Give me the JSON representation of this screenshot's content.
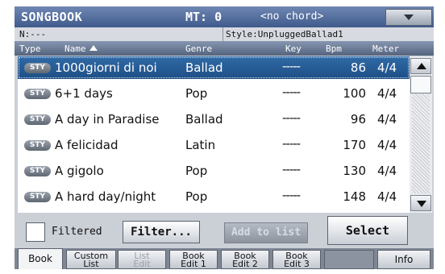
{
  "titlebar": {
    "app": "SONGBOOK",
    "mt": "MT: 0",
    "chord": "<no chord>"
  },
  "infobar": {
    "number": "N:---",
    "style": "Style:UnpluggedBallad1"
  },
  "columns": {
    "type": "Type",
    "name": "Name",
    "genre": "Genre",
    "key": "Key",
    "bpm": "Bpm",
    "meter": "Meter"
  },
  "rows": [
    {
      "badge": "STY",
      "name": "1000giorni di noi",
      "genre": "Ballad",
      "key": "-----",
      "bpm": "86",
      "meter": "4/4",
      "selected": true
    },
    {
      "badge": "STY",
      "name": "6+1 days",
      "genre": "Pop",
      "key": "-----",
      "bpm": "100",
      "meter": "4/4"
    },
    {
      "badge": "STY",
      "name": "A day in Paradise",
      "genre": "Ballad",
      "key": "-----",
      "bpm": "96",
      "meter": "4/4"
    },
    {
      "badge": "STY",
      "name": "A felicidad",
      "genre": "Latin",
      "key": "-----",
      "bpm": "170",
      "meter": "4/4"
    },
    {
      "badge": "STY",
      "name": "A gigolo",
      "genre": "Pop",
      "key": "-----",
      "bpm": "130",
      "meter": "4/4"
    },
    {
      "badge": "STY",
      "name": "A hard day/night",
      "genre": "Pop",
      "key": "-----",
      "bpm": "148",
      "meter": "4/4"
    }
  ],
  "controls": {
    "filtered_label": "Filtered",
    "filter_button": "Filter...",
    "add_to_list_button": "Add to list",
    "select_button": "Select"
  },
  "tabs": [
    {
      "l1": "Book",
      "l2": ""
    },
    {
      "l1": "Custom",
      "l2": "List"
    },
    {
      "l1": "List",
      "l2": "Edit"
    },
    {
      "l1": "Book",
      "l2": "Edit 1"
    },
    {
      "l1": "Book",
      "l2": "Edit 2"
    },
    {
      "l1": "Book",
      "l2": "Edit 3"
    },
    {
      "l1": "",
      "l2": ""
    },
    {
      "l1": "Info",
      "l2": ""
    }
  ],
  "colors": {
    "title_bar": "#3f5a8c",
    "selected_row": "#1f4f86",
    "panel": "#cbd0d7"
  }
}
